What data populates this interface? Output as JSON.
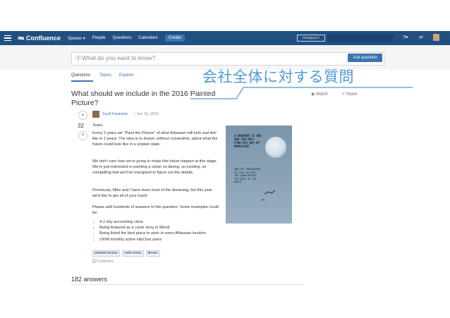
{
  "nav": {
    "logo": "Confluence",
    "items": [
      "Spaces ▾",
      "People",
      "Questions",
      "Calendars"
    ],
    "create": "Create",
    "feedback": "FEEDBACK?"
  },
  "search": {
    "placeholder": "What do you want to know?",
    "ask_button": "Ask question"
  },
  "tabs": [
    "Questions",
    "Topics",
    "Experts"
  ],
  "overlay_text": "会社全体に対する質問",
  "question": {
    "title": "What should we include in the 2016 Painted Picture?",
    "watch": "Watch",
    "share": "Share",
    "votes": "32",
    "author": "Scott Farquhar",
    "date": "• Jun 16, 2015",
    "paragraphs": [
      "Team,",
      "Every 2 years we \"Paint the Picture\" of what Atlassian will look and feel like in 2 years. The idea is to dream, without constraints, about what the future could look like in a utopian state.",
      "We don't care how we're going to make this future happen at this stage. We're just interested in painting a vision so daring, so exciting, so compelling that we'll be energised to figure out the details.",
      "Previously, Mike and I have done most of the dreaming, but this year we'd like to get all of your input!",
      "Please add hundreds of answers to this question. Some examples could be:"
    ],
    "bullets": [
      "A 2 day accounting close",
      "Being featured as a cover story in Wired",
      "Being listed the best place to work in every Atlassian location",
      "100M monthly active HipChat users"
    ],
    "tags": [
      "painted-picture",
      "vivid-vision",
      "dream"
    ],
    "comment": "Comment"
  },
  "poster": {
    "headline": "A DREAMER IS ONE WHO CAN ONLY FIND HIS WAY BY MOONLIGHT",
    "subline": "AND HIS PUNISHMENT IS THAT HE SEES THE DAWN BEFORE THE REST OF THE WORLD"
  },
  "answers_count": "182 answers"
}
